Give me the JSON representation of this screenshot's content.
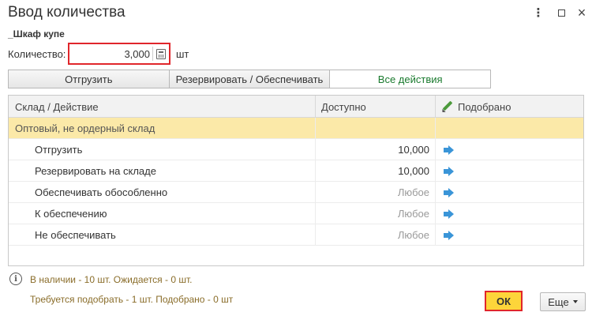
{
  "window": {
    "title": "Ввод количества",
    "more_icon": "more-vertical-icon",
    "maximize_icon": "maximize-icon",
    "close_icon": "close-icon",
    "close_glyph": "×"
  },
  "product": {
    "name": "_Шкаф купе"
  },
  "quantity": {
    "label": "Количество:",
    "value": "3,000",
    "unit": "шт",
    "icon": "calculator-icon"
  },
  "tabs": [
    {
      "label": "Отгрузить",
      "active": false
    },
    {
      "label": "Резервировать / Обеспечивать",
      "active": false
    },
    {
      "label": "Все действия",
      "active": true
    }
  ],
  "table": {
    "columns": [
      "Склад / Действие",
      "Доступно",
      "Подобрано"
    ],
    "group_row": {
      "label": "Оптовый, не ордерный склад"
    },
    "rows": [
      {
        "action": "Отгрузить",
        "available": "10,000",
        "muted": false
      },
      {
        "action": "Резервировать на складе",
        "available": "10,000",
        "muted": false
      },
      {
        "action": "Обеспечивать обособленно",
        "available": "Любое",
        "muted": true
      },
      {
        "action": "К обеспечению",
        "available": "Любое",
        "muted": true
      },
      {
        "action": "Не обеспечивать",
        "available": "Любое",
        "muted": true
      }
    ]
  },
  "info": {
    "line1": "В наличии - 10 шт. Ожидается - 0 шт.",
    "line2": "Требуется подобрать - 1 шт. Подобрано - 0 шт"
  },
  "buttons": {
    "ok_label": "ОК",
    "more_label": "Еще"
  },
  "colors": {
    "accent_yellow": "#fdd53a",
    "highlight_red": "#e0262b",
    "group_row_bg": "#fbe9a8",
    "active_tab_text": "#1a7a2e",
    "info_text": "#8a6d2a",
    "arrow_blue": "#3a95d8"
  }
}
